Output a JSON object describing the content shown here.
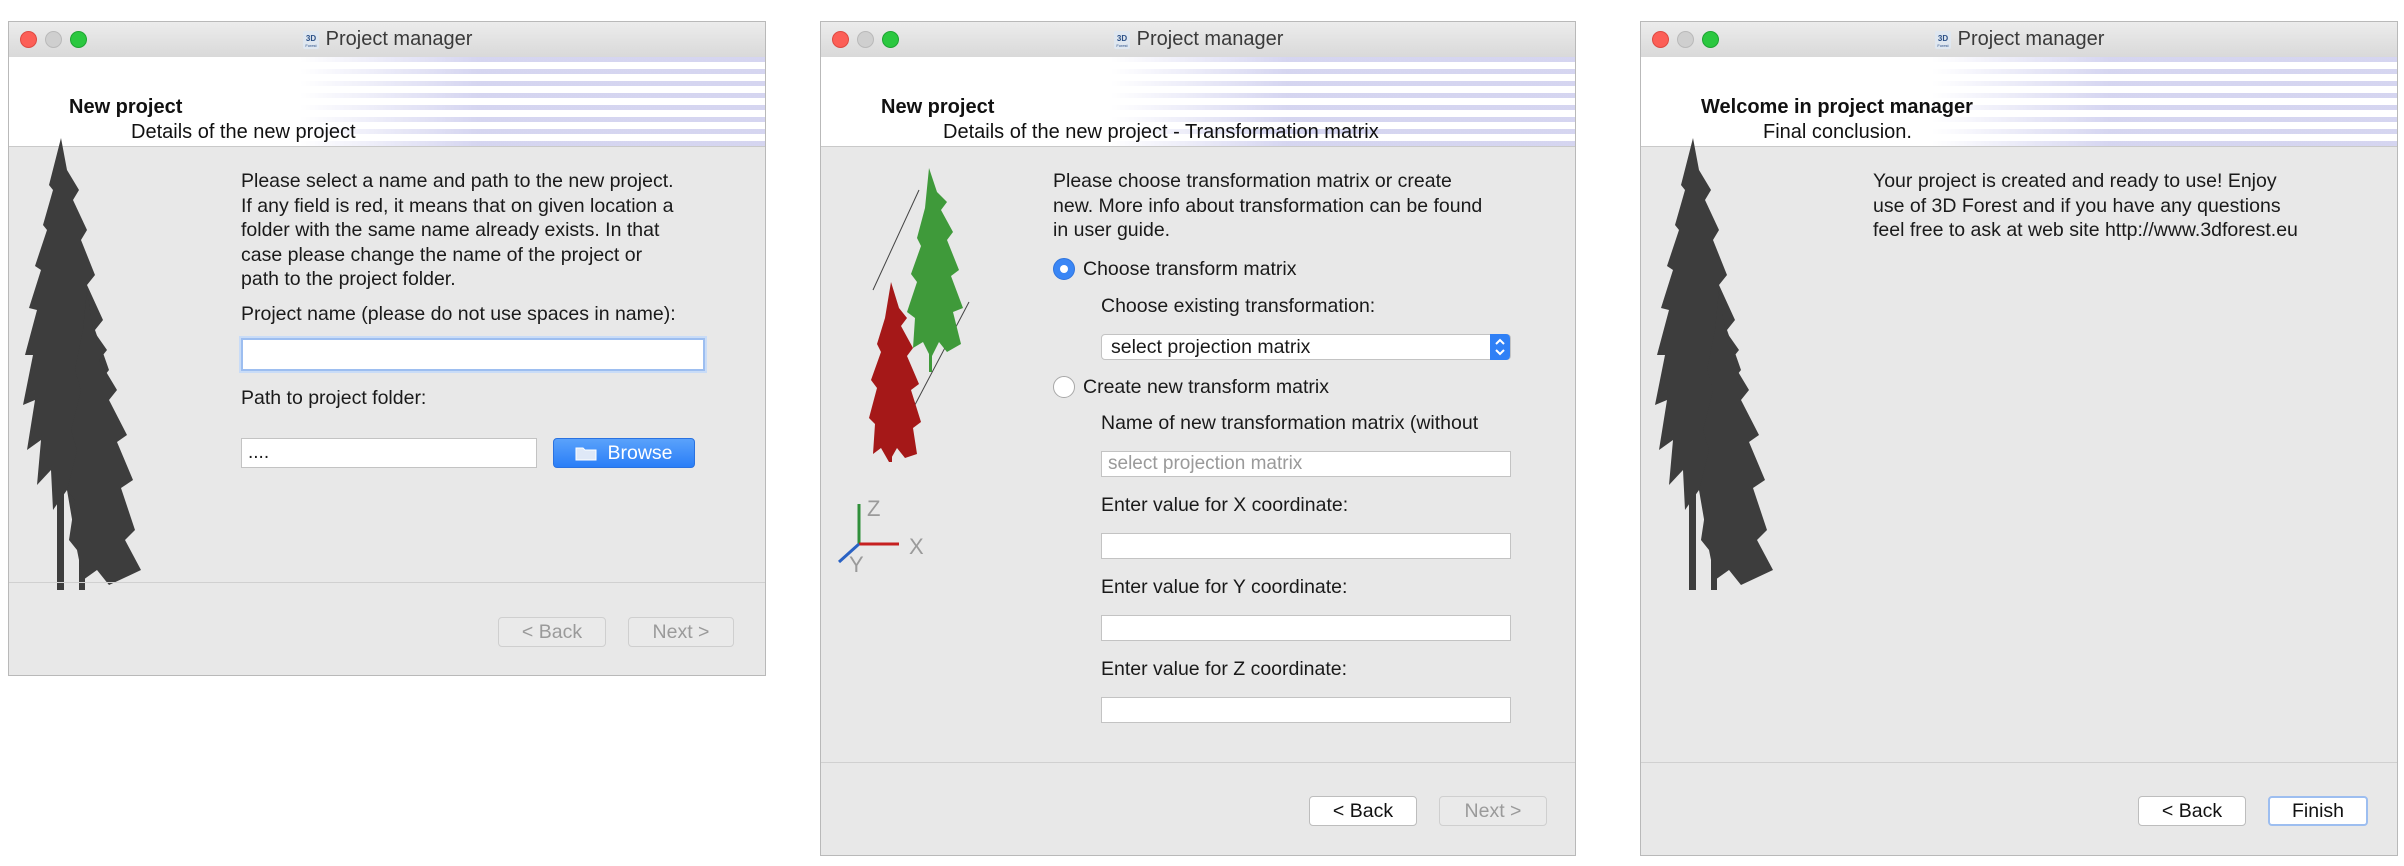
{
  "windows": [
    {
      "title": "Project manager",
      "header_title": "New project",
      "header_subtitle": "Details of the new project",
      "description": [
        "Please select a name and path to the new project.",
        "If any field is red, it means that on given location a",
        "folder with the same name already exists. In that",
        "case please change the name of the project or",
        "path to the project folder."
      ],
      "project_name_label": "Project name (please do not use spaces in name):",
      "project_name_value": "",
      "path_label": "Path to project folder:",
      "path_value": "....",
      "browse_label": "Browse",
      "back_label": "< Back",
      "next_label": "Next >"
    },
    {
      "title": "Project manager",
      "header_title": "New project",
      "header_subtitle": "Details of the new project - Transformation matrix",
      "description": [
        "Please choose transformation matrix or create",
        "new. More info about transformation can be found",
        "in user guide."
      ],
      "choose_radio_label": "Choose transform matrix",
      "choose_existing_label": "Choose existing transformation:",
      "select_value": "select projection matrix",
      "create_radio_label": "Create new transform matrix",
      "name_label": "Name of new transformation matrix (without",
      "name_placeholder": "select projection matrix",
      "x_label": "Enter value for X coordinate:",
      "y_label": "Enter value for Y coordinate:",
      "z_label": "Enter value for Z coordinate:",
      "axis_x": "X",
      "axis_y": "Y",
      "axis_z": "Z",
      "back_label": "< Back",
      "next_label": "Next >"
    },
    {
      "title": "Project manager",
      "header_title": "Welcome in project manager",
      "header_subtitle": "Final conclusion.",
      "description": [
        "Your project is created and ready to use! Enjoy",
        "use of 3D Forest and if you have any questions",
        "feel free to ask at web site http://www.3dforest.eu"
      ],
      "back_label": "< Back",
      "finish_label": "Finish"
    }
  ],
  "colors": {
    "accent_blue": "#2f80f6",
    "tree_green": "#3f9a3a",
    "tree_red": "#a51818",
    "axis_z": "#2f8f3a",
    "axis_x": "#c62020",
    "axis_y": "#2a62c4"
  },
  "icons": {
    "app": "3d-forest-icon",
    "folder": "folder-icon",
    "tree": "tree-silhouette-icon",
    "axes": "xyz-axes-icon"
  }
}
